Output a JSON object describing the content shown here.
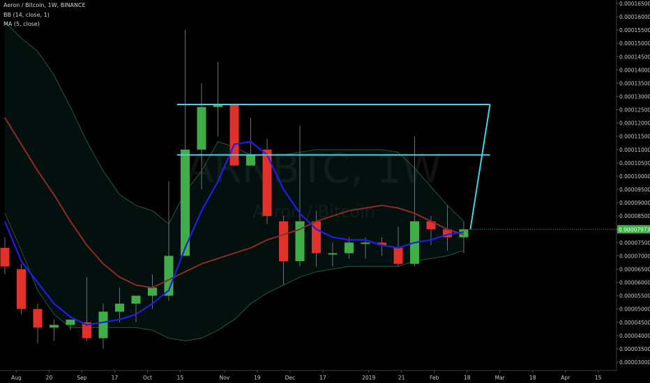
{
  "legend": {
    "symbol": "Aeron / Bitcoin, 1W, BINANCE",
    "bb": "BB (14, close, 1)",
    "ma": "MA (5, close)"
  },
  "watermark": {
    "ticker": "ARNBTC, 1W",
    "name": "Aeron / Bitcoin"
  },
  "colors": {
    "background": "#000000",
    "up": "#3fae49",
    "down": "#e0312a",
    "ma": "#1f1fe8",
    "bb_basis": "#8b2c2c",
    "bb_band": "#22564a",
    "drawing": "#38d9ea",
    "last_price_bg": "#3fae49"
  },
  "last_price_label": "0.00007973",
  "chart_data": {
    "type": "candlestick",
    "ylim": [
      2.8e-06,
      1.65e-05
    ],
    "y_ticks": [
      "0.00016500",
      "0.00016000",
      "0.00015500",
      "0.00015000",
      "0.00014500",
      "0.00014000",
      "0.00013500",
      "0.00013000",
      "0.00012500",
      "0.00012000",
      "0.00011500",
      "0.00011000",
      "0.00010500",
      "0.00010000",
      "0.00009500",
      "0.00009000",
      "0.00008500",
      "0.00008000",
      "0.00007500",
      "0.00007000",
      "0.00006500",
      "0.00006000",
      "0.00005500",
      "0.00005000",
      "0.00004500",
      "0.00004000",
      "0.00003500",
      "0.00003000"
    ],
    "y_tick_values": [
      1.65e-05,
      1.6e-05,
      1.55e-05,
      1.5e-05,
      1.45e-05,
      1.4e-05,
      1.35e-05,
      1.3e-05,
      1.25e-05,
      1.2e-05,
      1.15e-05,
      1.1e-05,
      1.05e-05,
      1e-05,
      9.5e-06,
      9e-06,
      8.5e-06,
      8e-06,
      7.5e-06,
      7e-06,
      6.5e-06,
      6e-06,
      5.5e-06,
      5e-06,
      4.5e-06,
      4e-06,
      3.5e-06,
      3e-06
    ],
    "x_tick_labels": [
      "Aug",
      "20",
      "Sep",
      "17",
      "Oct",
      "15",
      "Nov",
      "19",
      "Dec",
      "17",
      "2019",
      "21",
      "Feb",
      "18",
      "Mar",
      "18",
      "Apr",
      "15"
    ],
    "x_tick_weeks": [
      0.7,
      2.7,
      4.7,
      6.7,
      8.7,
      10.7,
      13.4,
      15.4,
      17.4,
      19.4,
      22.2,
      24.2,
      26.2,
      28.2,
      30.2,
      32.2,
      34.2,
      36.2
    ],
    "candles": [
      {
        "week": 0,
        "open": 7.3e-06,
        "high": 7.7e-06,
        "low": 6.3e-06,
        "close": 6.6e-06
      },
      {
        "week": 1,
        "open": 6.5e-06,
        "high": 6.7e-06,
        "low": 4.8e-06,
        "close": 5e-06
      },
      {
        "week": 2,
        "open": 5e-06,
        "high": 5.2e-06,
        "low": 3.7e-06,
        "close": 4.3e-06
      },
      {
        "week": 3,
        "open": 4.3e-06,
        "high": 4.6e-06,
        "low": 3.8e-06,
        "close": 4.4e-06
      },
      {
        "week": 4,
        "open": 4.4e-06,
        "high": 4.6e-06,
        "low": 4.2e-06,
        "close": 4.6e-06
      },
      {
        "week": 5,
        "open": 4.5e-06,
        "high": 6.2e-06,
        "low": 3.8e-06,
        "close": 3.9e-06
      },
      {
        "week": 6,
        "open": 3.9e-06,
        "high": 5.2e-06,
        "low": 3.5e-06,
        "close": 4.9e-06
      },
      {
        "week": 7,
        "open": 4.9e-06,
        "high": 5.8e-06,
        "low": 4.5e-06,
        "close": 5.2e-06
      },
      {
        "week": 8,
        "open": 5.2e-06,
        "high": 5.5e-06,
        "low": 4.5e-06,
        "close": 5.5e-06
      },
      {
        "week": 9,
        "open": 5.5e-06,
        "high": 6.3e-06,
        "low": 5e-06,
        "close": 5.8e-06
      },
      {
        "week": 10,
        "open": 5.5e-06,
        "high": 9.8e-06,
        "low": 5.3e-06,
        "close": 7e-06
      },
      {
        "week": 11,
        "open": 7e-06,
        "high": 1.55e-05,
        "low": 7e-06,
        "close": 1.1e-05
      },
      {
        "week": 12,
        "open": 1.1e-05,
        "high": 1.35e-05,
        "low": 9.5e-06,
        "close": 1.26e-05
      },
      {
        "week": 13,
        "open": 1.26e-05,
        "high": 1.43e-05,
        "low": 1.15e-05,
        "close": 1.27e-05
      },
      {
        "week": 14,
        "open": 1.27e-05,
        "high": 1.27e-05,
        "low": 1.04e-05,
        "close": 1.04e-05
      },
      {
        "week": 15,
        "open": 1.04e-05,
        "high": 1.22e-05,
        "low": 1.04e-05,
        "close": 1.08e-05
      },
      {
        "week": 16,
        "open": 1.1e-05,
        "high": 1.14e-05,
        "low": 8.2e-06,
        "close": 8.5e-06
      },
      {
        "week": 17,
        "open": 8.3e-06,
        "high": 8.5e-06,
        "low": 5.9e-06,
        "close": 6.8e-06
      },
      {
        "week": 18,
        "open": 6.8e-06,
        "high": 1.19e-05,
        "low": 6.6e-06,
        "close": 8.3e-06
      },
      {
        "week": 19,
        "open": 8.3e-06,
        "high": 8.7e-06,
        "low": 6.6e-06,
        "close": 7.1e-06
      },
      {
        "week": 20,
        "open": 7.1e-06,
        "high": 7.5e-06,
        "low": 6.6e-06,
        "close": 7.1e-06
      },
      {
        "week": 21,
        "open": 7.1e-06,
        "high": 7.7e-06,
        "low": 6.9e-06,
        "close": 7.5e-06
      },
      {
        "week": 22,
        "open": 7.5e-06,
        "high": 7.7e-06,
        "low": 6.9e-06,
        "close": 7.5e-06
      },
      {
        "week": 23,
        "open": 7.5e-06,
        "high": 7.7e-06,
        "low": 7e-06,
        "close": 7.4e-06
      },
      {
        "week": 24,
        "open": 7.3e-06,
        "high": 8.1e-06,
        "low": 6.6e-06,
        "close": 6.7e-06
      },
      {
        "week": 25,
        "open": 6.7e-06,
        "high": 1.15e-05,
        "low": 6.6e-06,
        "close": 8.3e-06
      },
      {
        "week": 26,
        "open": 8.3e-06,
        "high": 8.5e-06,
        "low": 7.4e-06,
        "close": 8e-06
      },
      {
        "week": 27,
        "open": 8e-06,
        "high": 8.9e-06,
        "low": 7.2e-06,
        "close": 7.7e-06
      },
      {
        "week": 28,
        "open": 7.7e-06,
        "high": 8.3e-06,
        "low": 7.1e-06,
        "close": 8e-06
      }
    ],
    "ma": {
      "name": "MA (5, close)",
      "weeks": [
        0,
        1,
        2,
        3,
        4,
        5,
        6,
        7,
        8,
        9,
        10,
        11,
        12,
        13,
        14,
        15,
        16,
        17,
        18,
        19,
        20,
        21,
        22,
        23,
        24,
        25,
        26,
        27,
        28
      ],
      "values": [
        8.3e-06,
        6.8e-06,
        6e-06,
        5.2e-06,
        4.7e-06,
        4.4e-06,
        4.5e-06,
        4.6e-06,
        4.8e-06,
        5.2e-06,
        5.7e-06,
        7.3e-06,
        8.7e-06,
        9.8e-06,
        1.12e-05,
        1.13e-05,
        1.08e-05,
        9.5e-06,
        8.6e-06,
        8e-06,
        7.7e-06,
        7.6e-06,
        7.6e-06,
        7.4e-06,
        7.3e-06,
        7.5e-06,
        7.6e-06,
        7.8e-06,
        7.9e-06
      ]
    },
    "bb_basis": {
      "weeks": [
        0,
        1,
        2,
        3,
        4,
        5,
        6,
        7,
        8,
        9,
        10,
        11,
        12,
        13,
        14,
        15,
        16,
        17,
        18,
        19,
        20,
        21,
        22,
        23,
        24,
        25,
        26,
        27,
        28
      ],
      "values": [
        1.22e-05,
        1.12e-05,
        1.02e-05,
        9.3e-06,
        8.3e-06,
        7.4e-06,
        6.7e-06,
        6.2e-06,
        5.9e-06,
        5.8e-06,
        6.1e-06,
        6.4e-06,
        6.7e-06,
        6.9e-06,
        7.1e-06,
        7.3e-06,
        7.6e-06,
        7.8e-06,
        8e-06,
        8.3e-06,
        8.5e-06,
        8.7e-06,
        8.8e-06,
        8.9e-06,
        8.8e-06,
        8.6e-06,
        8.3e-06,
        8e-06,
        7.8e-06
      ]
    },
    "bb_upper": {
      "weeks": [
        0,
        1,
        2,
        3,
        4,
        5,
        6,
        7,
        8,
        9,
        10,
        11,
        12,
        13,
        14,
        15,
        16,
        17,
        18,
        19,
        20,
        21,
        22,
        23,
        24,
        25,
        26,
        27,
        28
      ],
      "values": [
        1.58e-05,
        1.52e-05,
        1.47e-05,
        1.38e-05,
        1.26e-05,
        1.13e-05,
        1.02e-05,
        9.3e-06,
        8.9e-06,
        8.7e-06,
        8.2e-06,
        9.4e-06,
        1.02e-05,
        1.13e-05,
        1.11e-05,
        1.08e-05,
        1.08e-05,
        1.08e-05,
        1.09e-05,
        1.1e-05,
        1.1e-05,
        1.1e-05,
        1.1e-05,
        1.1e-05,
        1.09e-05,
        1.03e-05,
        9.6e-06,
        8.9e-06,
        8.3e-06
      ]
    },
    "bb_lower": {
      "weeks": [
        0,
        1,
        2,
        3,
        4,
        5,
        6,
        7,
        8,
        9,
        10,
        11,
        12,
        13,
        14,
        15,
        16,
        17,
        18,
        19,
        20,
        21,
        22,
        23,
        24,
        25,
        26,
        27,
        28
      ],
      "values": [
        8.6e-06,
        7.2e-06,
        5.7e-06,
        4.8e-06,
        4.3e-06,
        4.3e-06,
        4.3e-06,
        4.3e-06,
        4.3e-06,
        4.2e-06,
        3.9e-06,
        3.8e-06,
        3.9e-06,
        4.2e-06,
        4.6e-06,
        5.2e-06,
        5.6e-06,
        5.9e-06,
        6.2e-06,
        6.4e-06,
        6.5e-06,
        6.6e-06,
        6.6e-06,
        6.6e-06,
        6.6e-06,
        6.8e-06,
        6.9e-06,
        7e-06,
        7.2e-06
      ]
    },
    "drawing": {
      "levels": [
        1.27e-05,
        1.08e-05
      ],
      "start_week": 10.5,
      "end_week": 29.6,
      "apex_week": 28.4,
      "apex_value": 8e-06
    }
  }
}
